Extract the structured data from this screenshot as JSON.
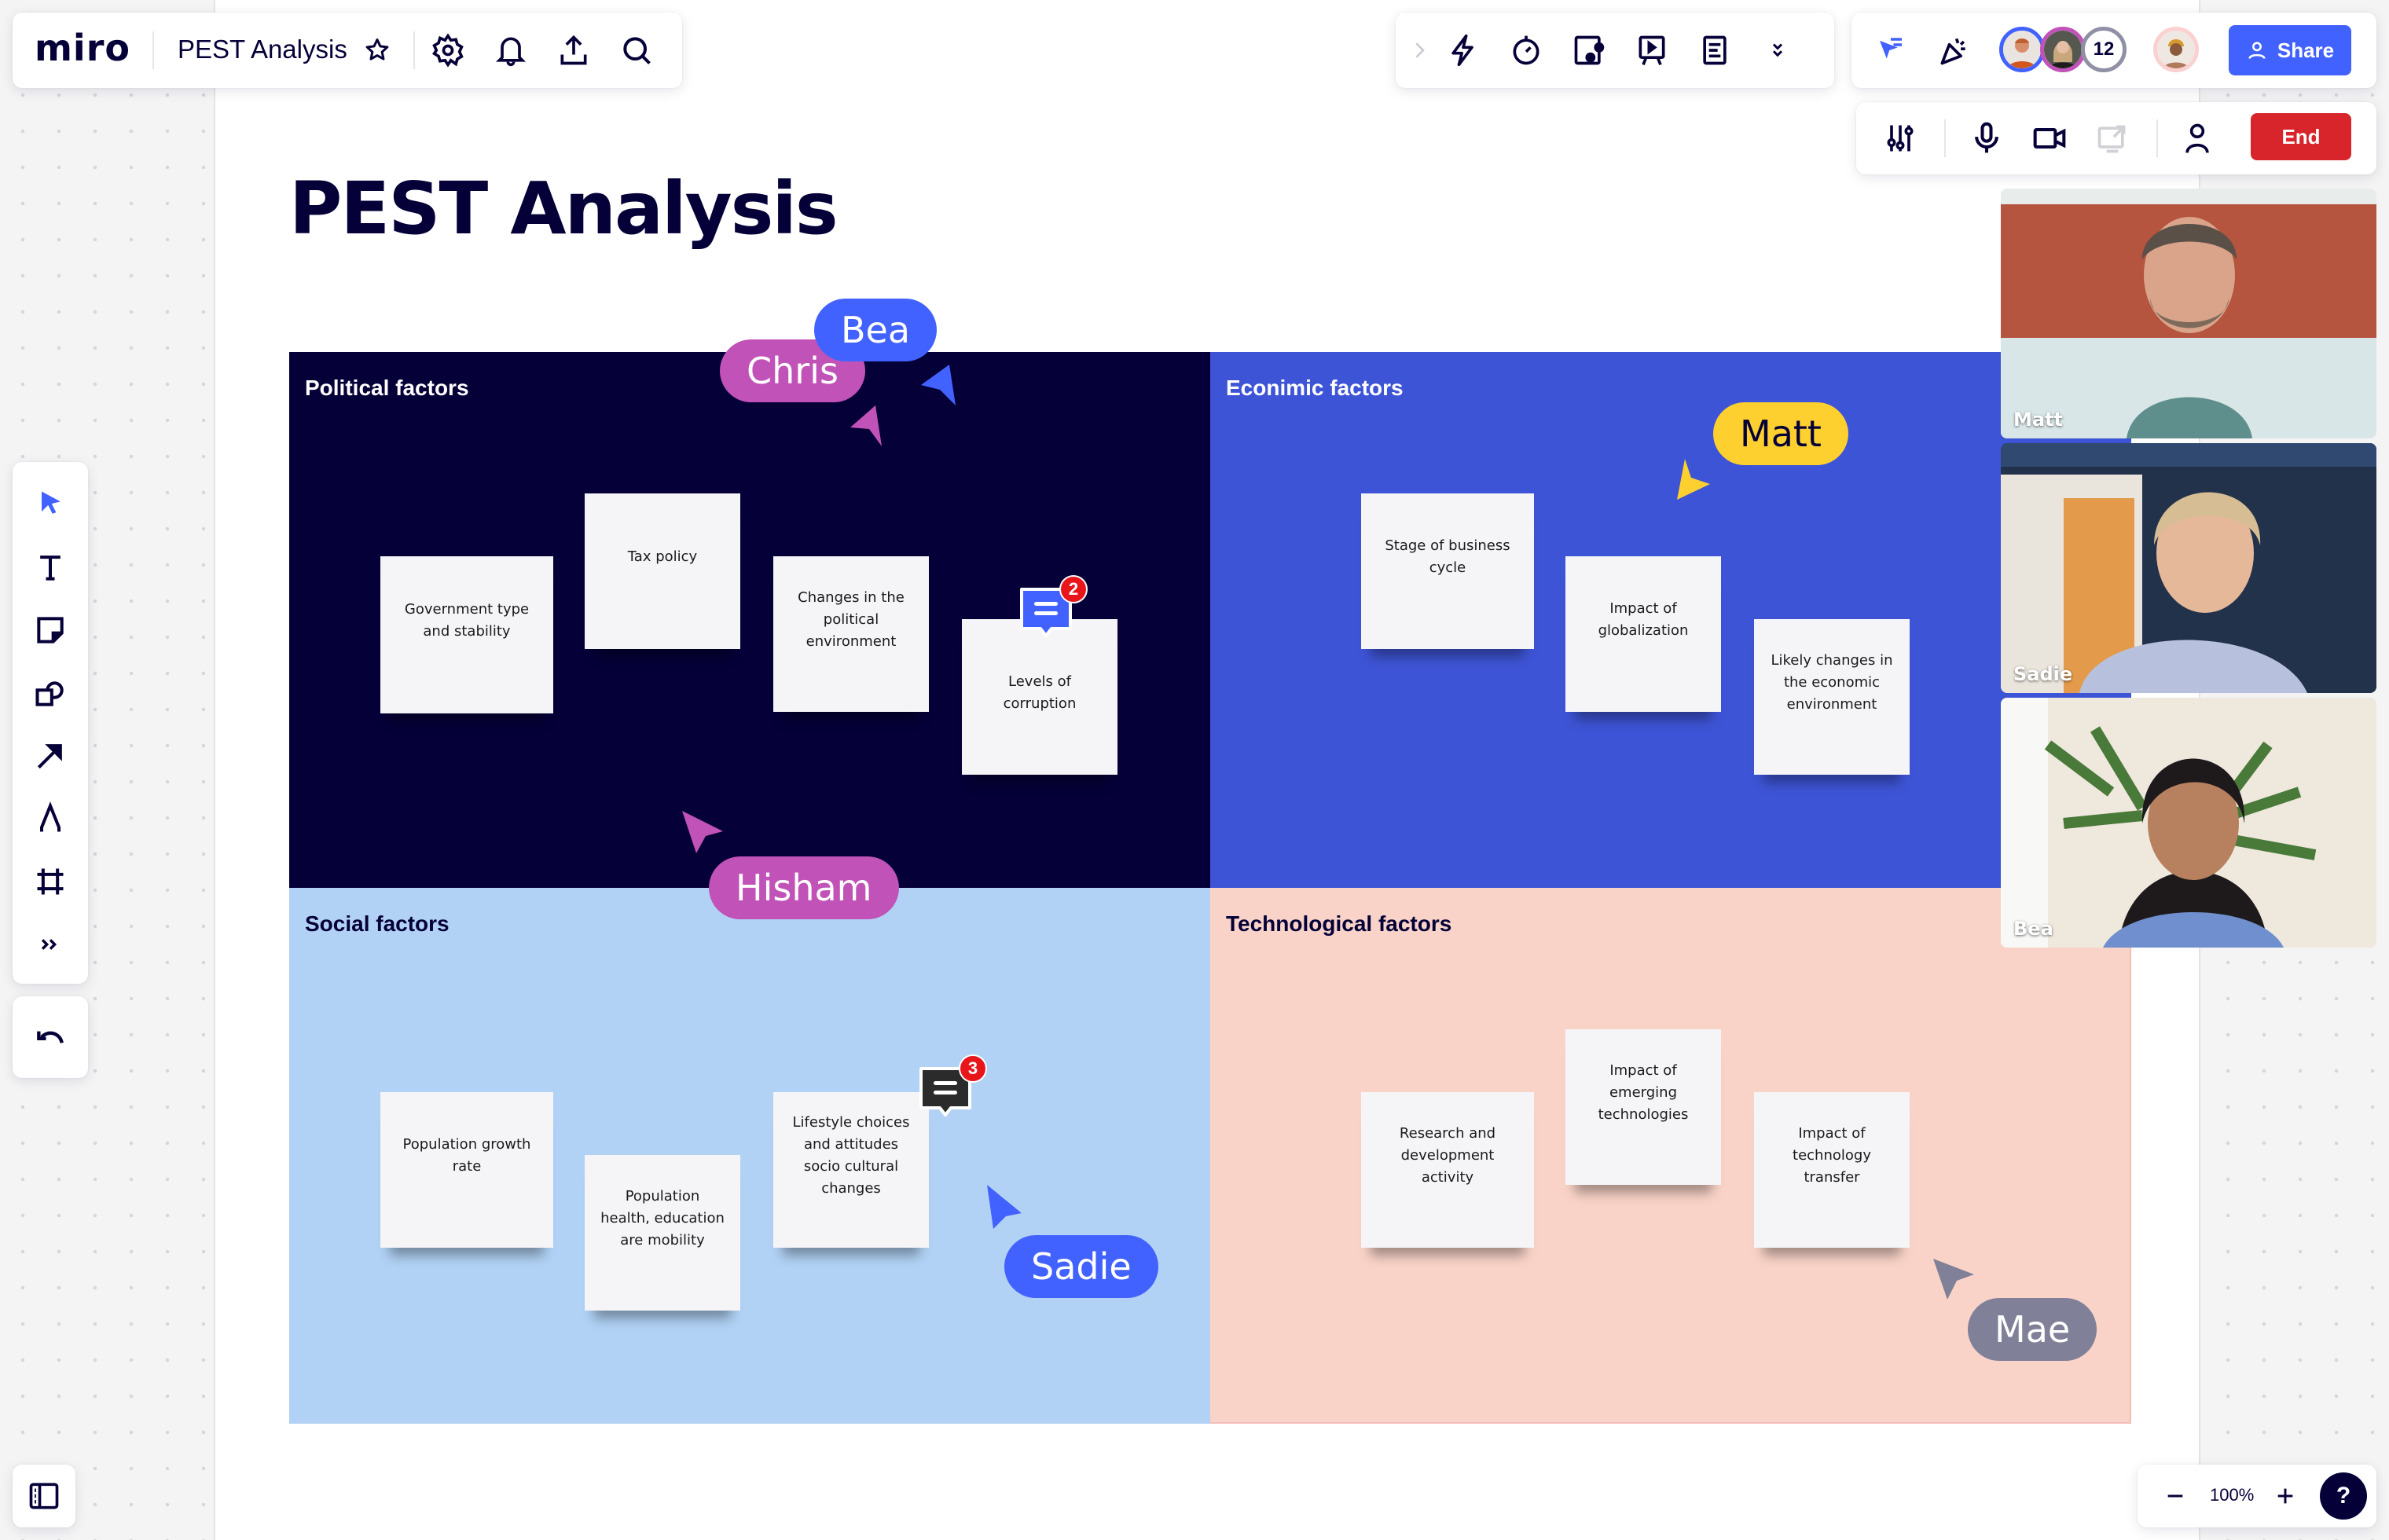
{
  "app": {
    "logo": "miro",
    "board_name": "PEST Analysis"
  },
  "top_left_toolbar": {
    "icons": [
      "star-icon",
      "gear-icon",
      "bell-icon",
      "upload-icon",
      "search-icon"
    ]
  },
  "top_center_toolbar": {
    "icons": [
      "chevron-right-icon",
      "lightning-icon",
      "timer-icon",
      "card-icon",
      "presentation-icon",
      "notes-icon",
      "chevron-double-down-icon"
    ]
  },
  "collaboration": {
    "avatars": [
      {
        "name": "avatar-1",
        "ring_color": "#4262ff"
      },
      {
        "name": "avatar-2",
        "ring_color": "#c152b8"
      }
    ],
    "more_count": "12",
    "current_user_ring": "#fbd0d0",
    "share_label": "Share"
  },
  "call_controls": {
    "icons": [
      "settings-sliders-icon",
      "microphone-icon",
      "camera-icon",
      "screen-share-icon",
      "person-icon"
    ],
    "end_label": "End"
  },
  "left_toolbar": {
    "tools": [
      "select-cursor-icon",
      "text-icon",
      "sticky-note-icon",
      "shapes-icon",
      "arrow-connector-icon",
      "pen-icon",
      "frame-icon",
      "more-tools-icon"
    ],
    "undo": "undo-icon"
  },
  "canvas": {
    "title": "PEST Analysis",
    "quadrants": [
      {
        "key": "political",
        "title": "Political factors",
        "bg": "#050038",
        "title_color": "#ffffff",
        "stickies": [
          "Government type and stability",
          "Tax policy",
          "Changes in the political environment",
          "Levels of corruption"
        ]
      },
      {
        "key": "economic",
        "title": "Econimic factors",
        "bg": "#3e54d6",
        "title_color": "#ffffff",
        "stickies": [
          "Stage of business cycle",
          "Impact of globalization",
          "Likely changes in the economic environment"
        ]
      },
      {
        "key": "social",
        "title": "Social factors",
        "bg": "#b1d2f5",
        "title_color": "#050038",
        "stickies": [
          "Population growth rate",
          "Population health, education are mobility",
          "Lifestyle choices and attitudes socio cultural changes"
        ]
      },
      {
        "key": "technological",
        "title": "Technological factors",
        "bg": "#f9d3c7",
        "title_color": "#050038",
        "stickies": [
          "Research and development activity",
          "Impact of emerging technologies",
          "Impact of technology transfer"
        ]
      }
    ],
    "comments": [
      {
        "on": "Levels of corruption",
        "count": "2",
        "color": "#4262ff"
      },
      {
        "on": "Lifestyle choices and attitudes socio cultural changes",
        "count": "3",
        "color": "#2b2b2b"
      }
    ],
    "cursors": [
      {
        "name": "Bea",
        "color": "#4262ff",
        "text_color": "#ffffff"
      },
      {
        "name": "Chris",
        "color": "#c152b8",
        "text_color": "#ffffff"
      },
      {
        "name": "Matt",
        "color": "#fdd02f",
        "text_color": "#050038"
      },
      {
        "name": "Hisham",
        "color": "#c152b8",
        "text_color": "#ffffff"
      },
      {
        "name": "Sadie",
        "color": "#4262ff",
        "text_color": "#ffffff"
      },
      {
        "name": "Mae",
        "color": "#808099",
        "text_color": "#ffffff"
      }
    ]
  },
  "video_tiles": [
    {
      "name": "Matt"
    },
    {
      "name": "Sadie"
    },
    {
      "name": "Bea"
    }
  ],
  "zoom_controls": {
    "zoom_level": "100%",
    "help_label": "?"
  }
}
